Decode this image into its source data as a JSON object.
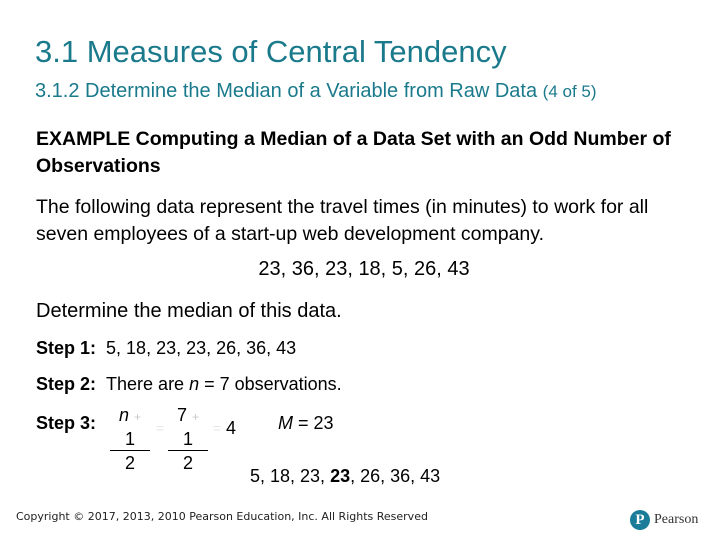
{
  "header": {
    "title": "3.1 Measures of Central Tendency",
    "subtitle": "3.1.2 Determine the Median of a Variable from Raw Data",
    "page_indicator": "(4 of 5)"
  },
  "example": {
    "heading_prefix": "EXAMPLE",
    "heading_text": " Computing a Median of a Data Set with an Odd Number of Observations"
  },
  "intro": "The following data represent the travel times (in minutes) to work for all seven employees of a start-up web development company.",
  "data_values": "23, 36, 23, 18, 5, 26, 43",
  "prompt": "Determine the median of this data.",
  "steps": [
    {
      "label": "Step 1:",
      "text": "5, 18, 23, 23, 26, 36, 43"
    },
    {
      "label": "Step 2:",
      "text_before": "There are ",
      "var": "n",
      "text_after": " = 7 observations."
    },
    {
      "label": "Step 3:",
      "frac1_num_var": "n",
      "frac1_num_op": "+",
      "frac1_num_const": "1",
      "frac1_den": "2",
      "eq1": "=",
      "frac2_num_a": "7",
      "frac2_num_op": "+",
      "frac2_num_b": "1",
      "frac2_den": "2",
      "eq2": "=",
      "result": "4",
      "median_var": "M",
      "median_text": " = 23"
    }
  ],
  "sorted": {
    "before": "5, 18, 23, ",
    "highlight": "23",
    "after": ", 26, 36, 43"
  },
  "footer": {
    "copyright": "Copyright © 2017, 2013, 2010 Pearson Education, Inc. All Rights Reserved",
    "logo_letter": "P",
    "logo_text": "Pearson"
  }
}
